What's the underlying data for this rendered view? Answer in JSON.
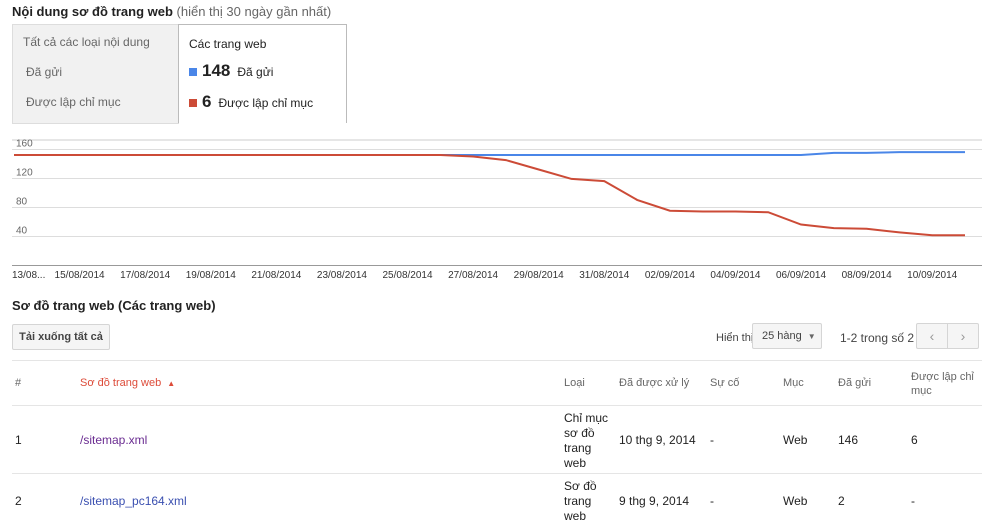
{
  "header": {
    "title": "Nội dung sơ đồ trang web",
    "subtitle": "(hiển thị 30 ngày gần nhất)"
  },
  "tabs_left": [
    {
      "label": "Tất cả các loại nội dung"
    },
    {
      "label": "Đã gửi"
    },
    {
      "label": "Được lập chỉ mục"
    }
  ],
  "tab_active": {
    "label": "Các trang web",
    "metrics": [
      {
        "value": "148",
        "label": "Đã gửi",
        "color": "#4a86e8"
      },
      {
        "value": "6",
        "label": "Được lập chỉ mục",
        "color": "#cc4b37"
      }
    ]
  },
  "chart_data": {
    "type": "line",
    "x": [
      "13/08/2014",
      "14/08/2014",
      "15/08/2014",
      "16/08/2014",
      "17/08/2014",
      "18/08/2014",
      "19/08/2014",
      "20/08/2014",
      "21/08/2014",
      "22/08/2014",
      "23/08/2014",
      "24/08/2014",
      "25/08/2014",
      "26/08/2014",
      "27/08/2014",
      "28/08/2014",
      "29/08/2014",
      "30/08/2014",
      "31/08/2014",
      "01/09/2014",
      "02/09/2014",
      "03/09/2014",
      "04/09/2014",
      "05/09/2014",
      "06/09/2014",
      "07/09/2014",
      "08/09/2014",
      "09/09/2014",
      "10/09/2014",
      "11/09/2014"
    ],
    "tick_labels": [
      "13/08...",
      "15/08/2014",
      "17/08/2014",
      "19/08/2014",
      "21/08/2014",
      "23/08/2014",
      "25/08/2014",
      "27/08/2014",
      "29/08/2014",
      "31/08/2014",
      "02/09/2014",
      "04/09/2014",
      "06/09/2014",
      "08/09/2014",
      "10/09/2014"
    ],
    "series": [
      {
        "name": "Đã gửi",
        "color": "#4a86e8",
        "values": [
          152,
          152,
          152,
          152,
          152,
          152,
          152,
          152,
          152,
          152,
          152,
          152,
          152,
          152,
          152,
          152,
          152,
          152,
          152,
          152,
          152,
          152,
          152,
          152,
          152,
          155,
          155,
          156,
          156,
          156
        ]
      },
      {
        "name": "Được lập chỉ mục",
        "color": "#cc4b37",
        "values": [
          152,
          152,
          152,
          152,
          152,
          152,
          152,
          152,
          152,
          152,
          152,
          152,
          152,
          152,
          150,
          145,
          132,
          119,
          116,
          90,
          75,
          74,
          74,
          73,
          56,
          51,
          50,
          45,
          41,
          41
        ]
      }
    ],
    "yticks": [
      40,
      80,
      120,
      160
    ],
    "ylim": [
      0,
      170
    ]
  },
  "sitemaps": {
    "title": "Sơ đồ trang web (Các trang web)",
    "download_label": "Tải xuống tất cả",
    "show_label": "Hiển thị",
    "rows_option": "25 hàng",
    "page_info": "1-2 trong số 2",
    "prev_icon": "‹",
    "next_icon": "›",
    "columns": [
      "#",
      "Sơ đồ trang web",
      "Loại",
      "Đã được xử lý",
      "Sự cố",
      "Mục",
      "Đã gửi",
      "Được lập chỉ mục"
    ],
    "sort_indicator": "▲",
    "rows": [
      {
        "num": "1",
        "path": "/sitemap.xml",
        "type": "Chỉ mục sơ đồ trang web",
        "processed": "10 thg 9, 2014",
        "issues": "-",
        "item": "Web",
        "submitted": "146",
        "indexed": "6"
      },
      {
        "num": "2",
        "path": "/sitemap_pc164.xml",
        "type": "Sơ đồ trang web",
        "processed": "9 thg 9, 2014",
        "issues": "-",
        "item": "Web",
        "submitted": "2",
        "indexed": "-"
      }
    ]
  }
}
